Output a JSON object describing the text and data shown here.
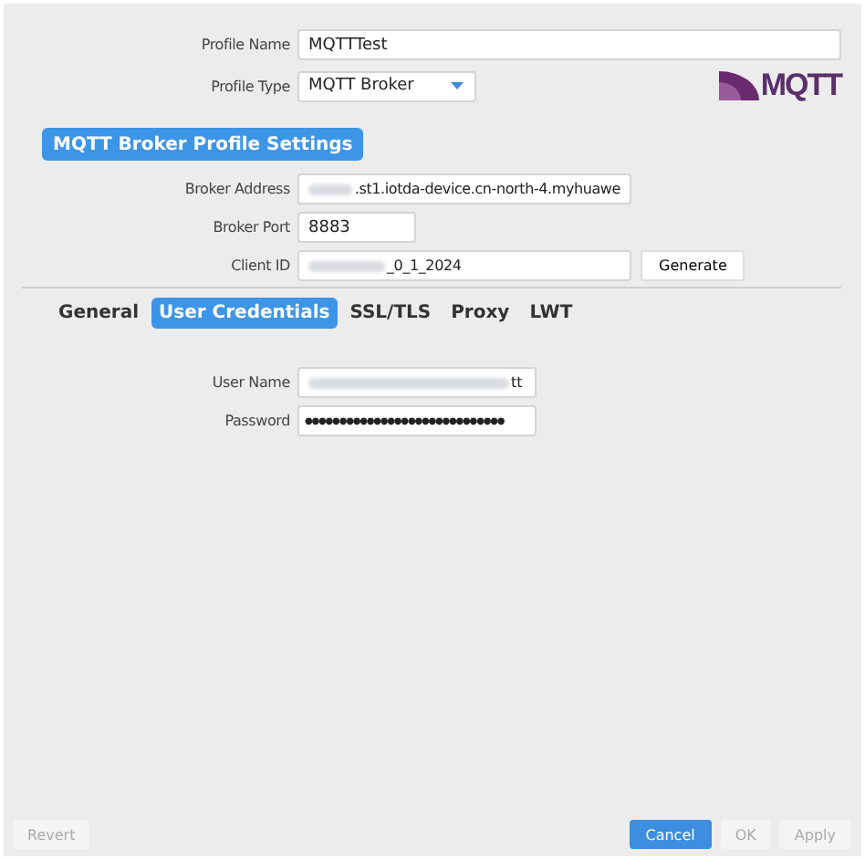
{
  "profile": {
    "name_label": "Profile Name",
    "name_value": "MQTTTest",
    "type_label": "Profile Type",
    "type_value": "MQTT Broker",
    "logo": "MQTT"
  },
  "settings_button": "MQTT Broker Profile Settings",
  "broker_fields": [
    {
      "label": "Broker Address",
      "value": ".st1.iotda-device.cn-north-4.myhuawe",
      "redacted": true,
      "kind": "wide"
    },
    {
      "label": "Broker Port",
      "value": "8883",
      "redacted": false,
      "kind": "short"
    },
    {
      "label": "Client ID",
      "value": "_0_1_2024",
      "redacted": true,
      "kind": "wide",
      "action": "Generate"
    }
  ],
  "tabs": [
    {
      "label": "General",
      "selected": false
    },
    {
      "label": "User Credentials",
      "selected": true
    },
    {
      "label": "SSL/TLS",
      "selected": false
    },
    {
      "label": "Proxy",
      "selected": false
    },
    {
      "label": "LWT",
      "selected": false
    }
  ],
  "credentials": [
    {
      "label": "User Name",
      "value": "tt",
      "redacted": true
    },
    {
      "label": "Password",
      "value": "●●●●●●●●●●●●●●●●●●●●●●●●●●●●●",
      "redacted": false
    }
  ],
  "footer": {
    "revert": "Revert",
    "cancel": "Cancel",
    "ok": "OK",
    "apply": "Apply"
  }
}
